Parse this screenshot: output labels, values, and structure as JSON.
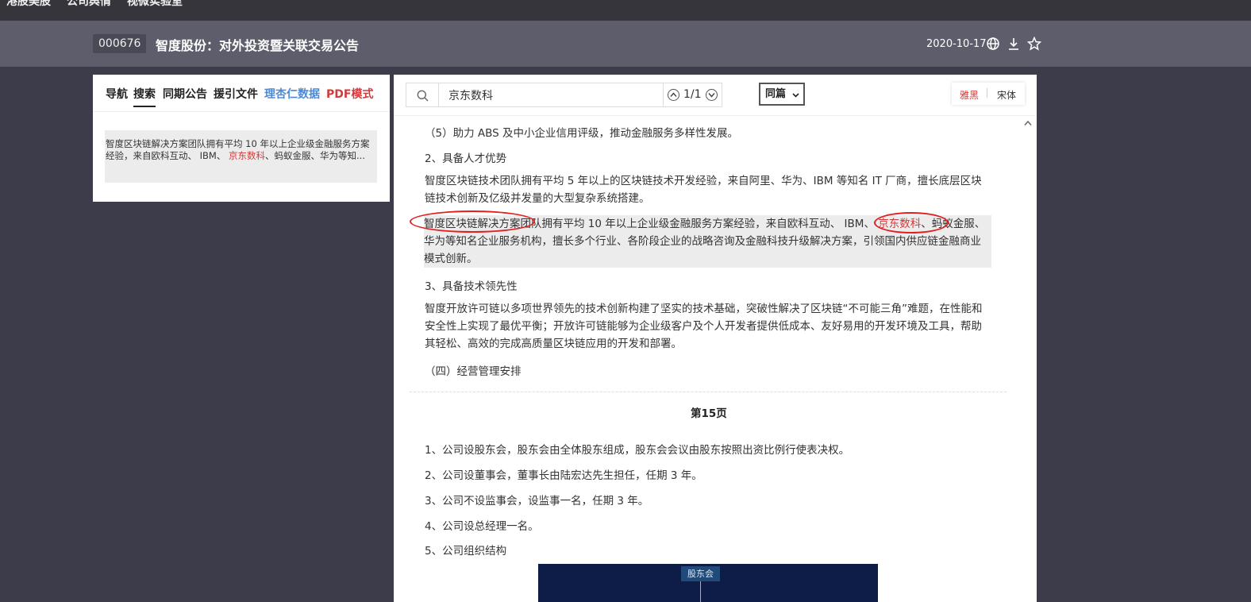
{
  "topnav": {
    "items": [
      "港股美股",
      "公司舆情",
      "视微实验室"
    ]
  },
  "header": {
    "stock_code": "000676",
    "title": "智度股份：对外投资暨关联交易公告",
    "date": "2020-10-17"
  },
  "sidebar": {
    "tabs": [
      {
        "label": "导航"
      },
      {
        "label": "搜索"
      },
      {
        "label": "同期公告"
      },
      {
        "label": "援引文件"
      },
      {
        "label": "理杏仁数据"
      },
      {
        "label": "PDF模式"
      }
    ],
    "search_result": {
      "text_before": "智度区块链解决方案团队拥有平均 10 年以上企业级金融服务方案经验，来自欧科互动、 IBM、 ",
      "keyword": "京东数科",
      "text_after": "、蚂蚁金服、华为等知名企业服务机构，擅长多个行业、各阶段企业的战略咨询及金融科技升级解决方案，引领国内供应链金融商业模式创新。",
      "display_after": "、蚂蚁金服、华为等知..."
    }
  },
  "toolbar": {
    "search_value": "京东数科",
    "match_count": "1/1",
    "scope_label": "同篇",
    "font_options": [
      "雅黑",
      "宋体"
    ],
    "active_font": "雅黑"
  },
  "content": {
    "lines": [
      "（5）助力 ABS 及中小企业信用评级，推动金融服务多样性发展。",
      "2、具备人才优势"
    ],
    "para1": "智度区块链技术团队拥有平均 5 年以上的区块链技术开发经验，来自阿里、华为、IBM 等知名 IT 厂商，擅长底层区块链技术创新及亿级并发量的大型复杂系统搭建。",
    "para2_before": "智度区块链解决方案团队拥有平均 10 年以上企业级金融服务方案经验，来自欧科互动、 IBM、 ",
    "para2_keyword": "京东数科",
    "para2_after": "、蚂蚁金服、华为等知名企业服务机构，擅长多个行业、各阶段企业的战略咨询及金融科技升级解决方案，引领国内供应链金融商业模式创新。",
    "line3": "3、具备技术领先性",
    "para3": "智度开放许可链以多项世界领先的技术创新构建了坚实的技术基础，突破性解决了区块链“不可能三角”难题，在性能和安全性上实现了最优平衡；开放许可链能够为企业级客户及个人开发者提供低成本、友好易用的开发环境及工具，帮助其轻松、高效的完成高质量区块链应用的开发和部署。",
    "line4": "（四）经营管理安排",
    "page_label": "第15页",
    "page15_items": [
      "1、公司设股东会，股东会由全体股东组成，股东会会议由股东按照出资比例行使表决权。",
      "2、公司设董事会，董事长由陆宏达先生担任，任期 3 年。",
      "3、公司不设监事会，设监事一名，任期 3 年。",
      "4、公司设总经理一名。",
      "5、公司组织结构"
    ],
    "org_chart_top_node": "股东会"
  },
  "icons": {
    "globe": "globe-icon",
    "download": "download-icon",
    "star": "star-icon",
    "search": "search-icon",
    "prev": "chevron-up-icon",
    "next": "chevron-down-icon"
  },
  "colors": {
    "highlight_keyword": "#d23b3b",
    "link_blue": "#4d8ad6",
    "header_bg": "#5d5d6b",
    "page_bg": "#3c3c4a",
    "annotation_red": "#e02020"
  }
}
